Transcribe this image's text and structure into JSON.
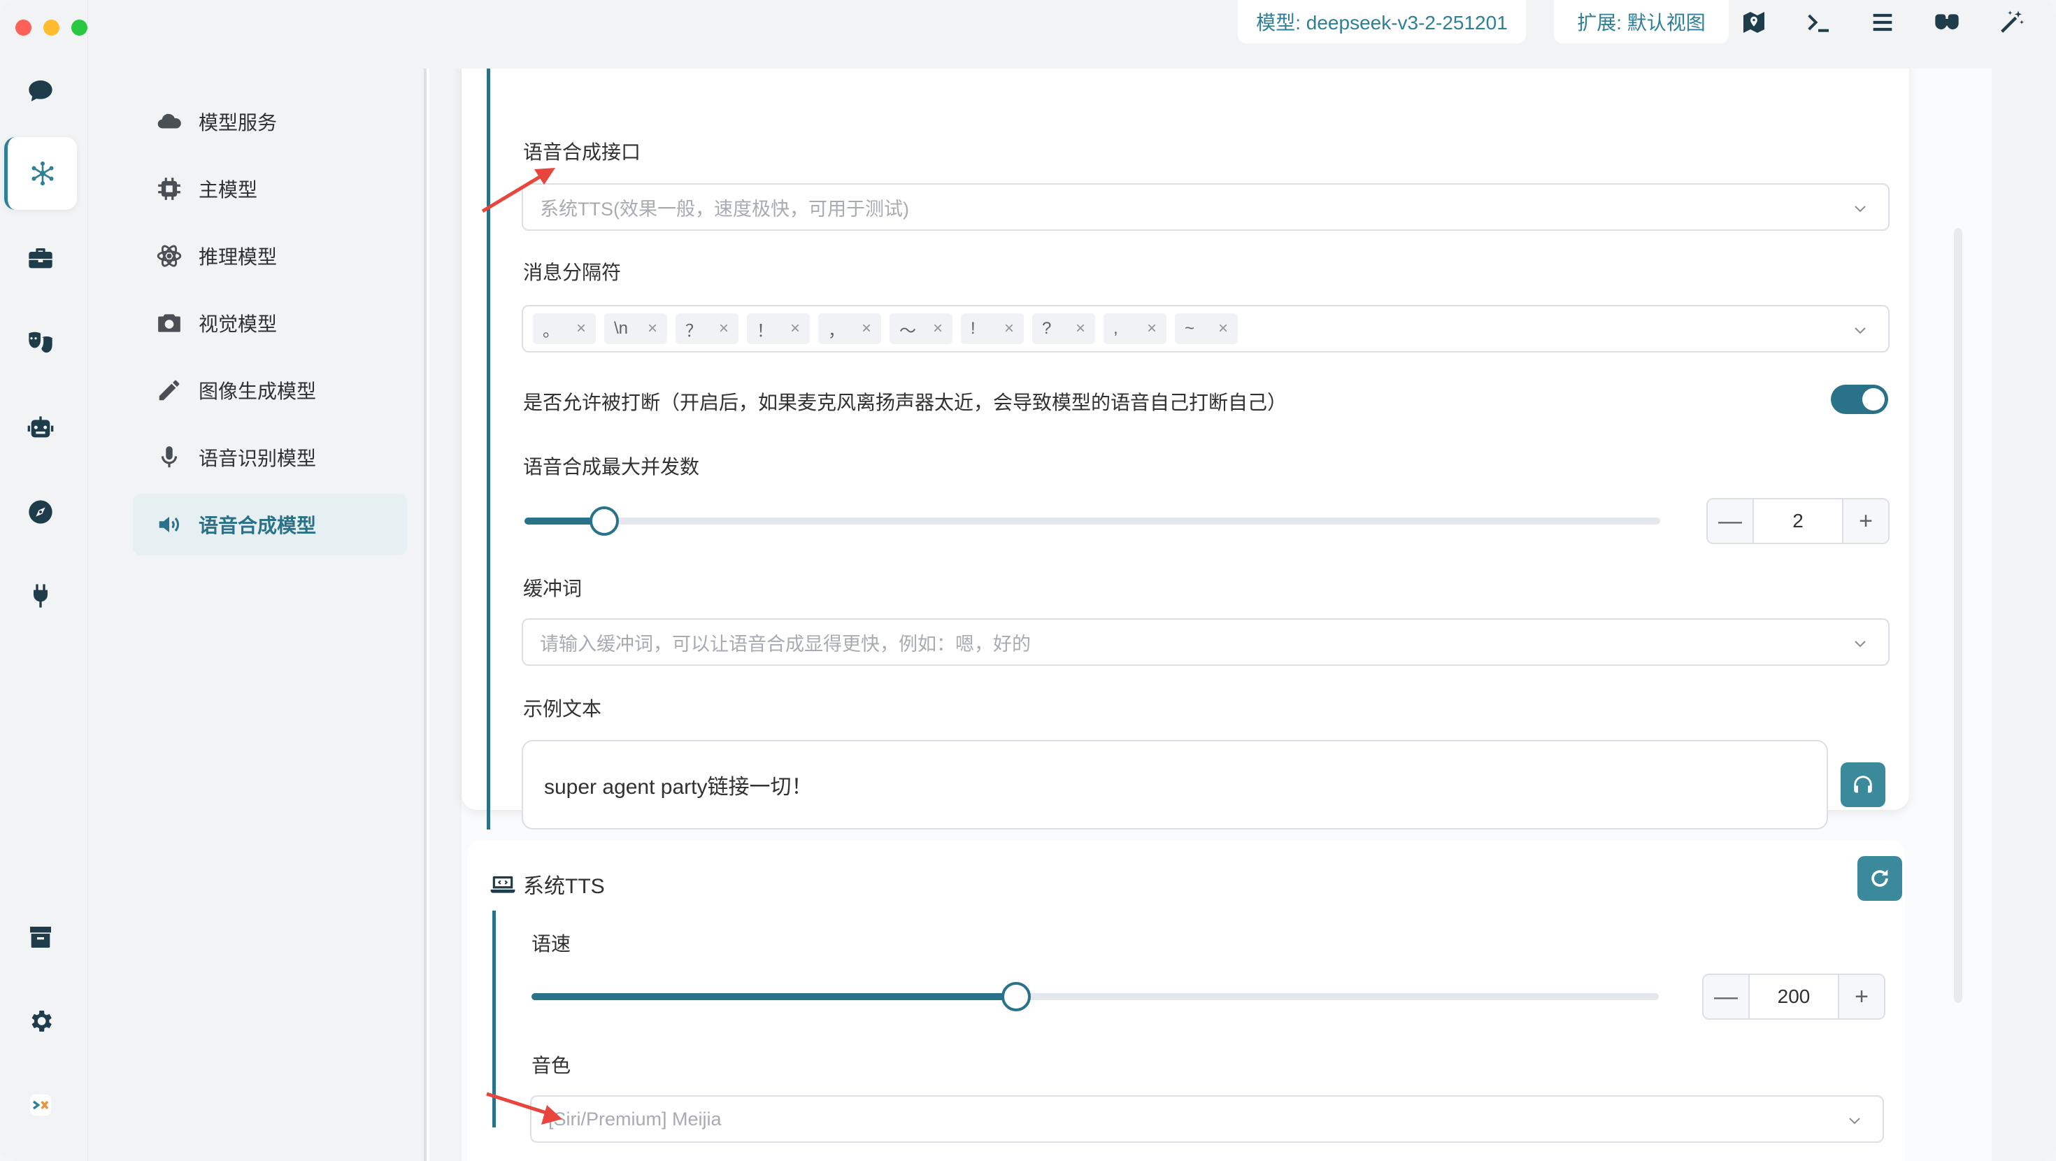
{
  "topbar": {
    "model_chip": "模型: deepseek-v3-2-251201",
    "extension_chip": "扩展: 默认视图"
  },
  "icons": {
    "rail": [
      "chat-icon",
      "model-hub-icon",
      "toolbox-icon",
      "theater-masks-icon",
      "robot-icon",
      "compass-icon",
      "plug-icon",
      "archive-icon",
      "gear-icon",
      "app-logo-icon"
    ],
    "top": [
      "map-icon",
      "terminal-icon",
      "menu-icon",
      "glasses-icon",
      "magic-wand-icon"
    ]
  },
  "sidebar": {
    "items": [
      {
        "label": "模型服务",
        "icon": "cloud-icon"
      },
      {
        "label": "主模型",
        "icon": "chip-icon"
      },
      {
        "label": "推理模型",
        "icon": "atom-icon"
      },
      {
        "label": "视觉模型",
        "icon": "camera-icon"
      },
      {
        "label": "图像生成模型",
        "icon": "pencil-icon"
      },
      {
        "label": "语音识别模型",
        "icon": "microphone-icon"
      },
      {
        "label": "语音合成模型",
        "icon": "speaker-icon"
      }
    ],
    "active_index": 6
  },
  "tts_settings": {
    "interface_label": "语音合成接口",
    "interface_value": "系统TTS(效果一般，速度极快，可用于测试)",
    "separator_label": "消息分隔符",
    "separators": [
      "。",
      "\\n",
      "？",
      "！",
      "，",
      "～",
      "!",
      "?",
      ",",
      "~"
    ],
    "interrupt_label": "是否允许被打断（开启后，如果麦克风离扬声器太近，会导致模型的语音自己打断自己）",
    "interrupt_enabled": true,
    "concurrency_label": "语音合成最大并发数",
    "concurrency_value": "2",
    "concurrency_fraction": 0.07,
    "buffer_label": "缓冲词",
    "buffer_placeholder": "请输入缓冲词，可以让语音合成显得更快，例如：嗯，好的",
    "sample_label": "示例文本",
    "sample_text": "super agent party链接一切！"
  },
  "system_tts": {
    "title": "系统TTS",
    "speed_label": "语速",
    "speed_value": "200",
    "speed_fraction": 0.43,
    "voice_label": "音色",
    "voice_value": "[Siri/Premium] Meijia"
  },
  "stepper_symbols": {
    "minus": "—",
    "plus": "+"
  },
  "colors": {
    "accent": "#2a7289",
    "annotation_arrow": "#e8453c"
  }
}
